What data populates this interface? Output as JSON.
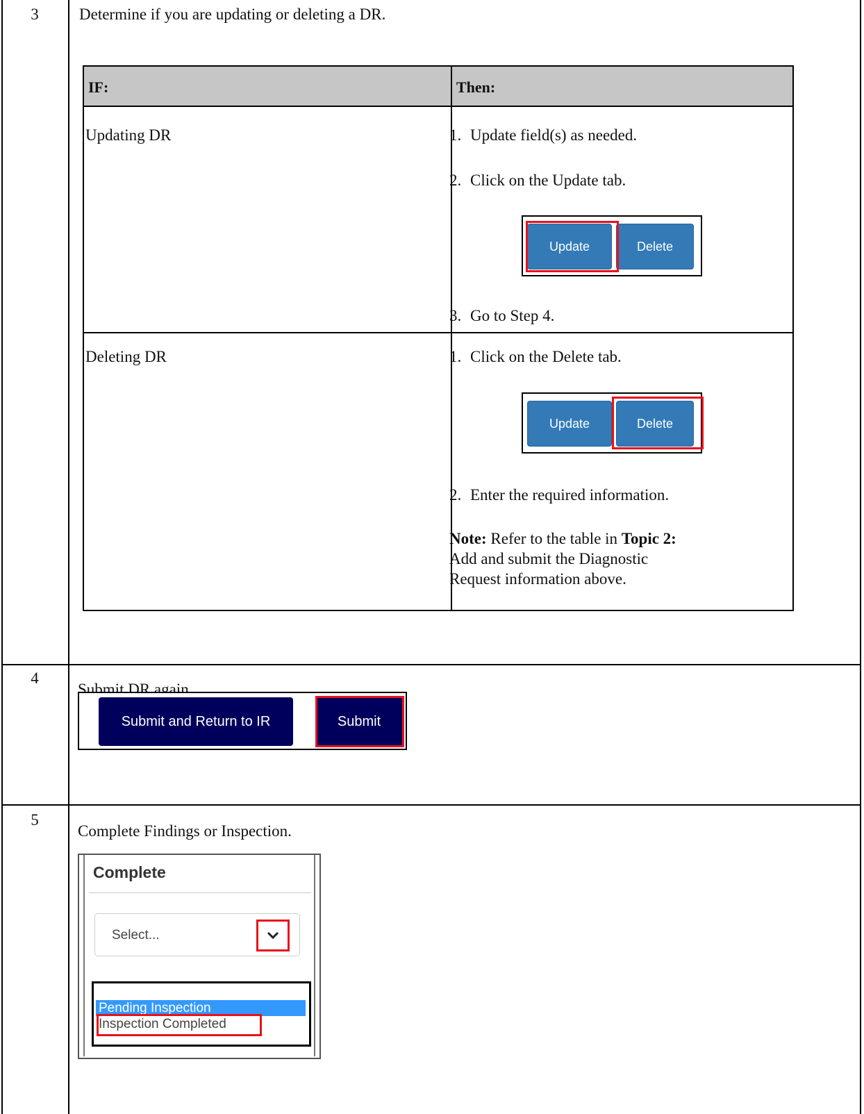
{
  "steps": [
    {
      "number": "3",
      "text": "Determine if you are updating or deleting a DR."
    },
    {
      "number": "4",
      "text": "Submit DR again."
    },
    {
      "number": "5",
      "text": "Complete Findings or Inspection."
    }
  ],
  "if_table": {
    "header_if": "IF:",
    "header_then": "Then:",
    "rows": [
      {
        "if": "Updating DR",
        "items": [
          "Update field(s) as needed.",
          "Click on the Update tab.",
          "Go to Step 4."
        ]
      },
      {
        "if": "Deleting DR",
        "items": [
          "Click on the Delete tab.",
          "Enter the required information."
        ],
        "note_label": "Note:",
        "note_text_1": " Refer to the table in ",
        "note_topic": "Topic 2:",
        "note_line2": "Add and submit the Diagnostic",
        "note_line3": "Request information above."
      }
    ],
    "item_numbers": [
      "1.",
      "2.",
      "3."
    ]
  },
  "buttons": {
    "update": "Update",
    "delete": "Delete"
  },
  "submit_bar": {
    "submit_return": "Submit and Return to IR",
    "submit": "Submit"
  },
  "complete_panel": {
    "title": "Complete",
    "select_placeholder": "Select...",
    "options": [
      "Pending Inspection",
      "Inspection Completed"
    ]
  },
  "colors": {
    "button_blue": "#337ab7",
    "navy": "#00005c",
    "highlight_red": "#e8111b",
    "selected_option": "#3399ff"
  }
}
